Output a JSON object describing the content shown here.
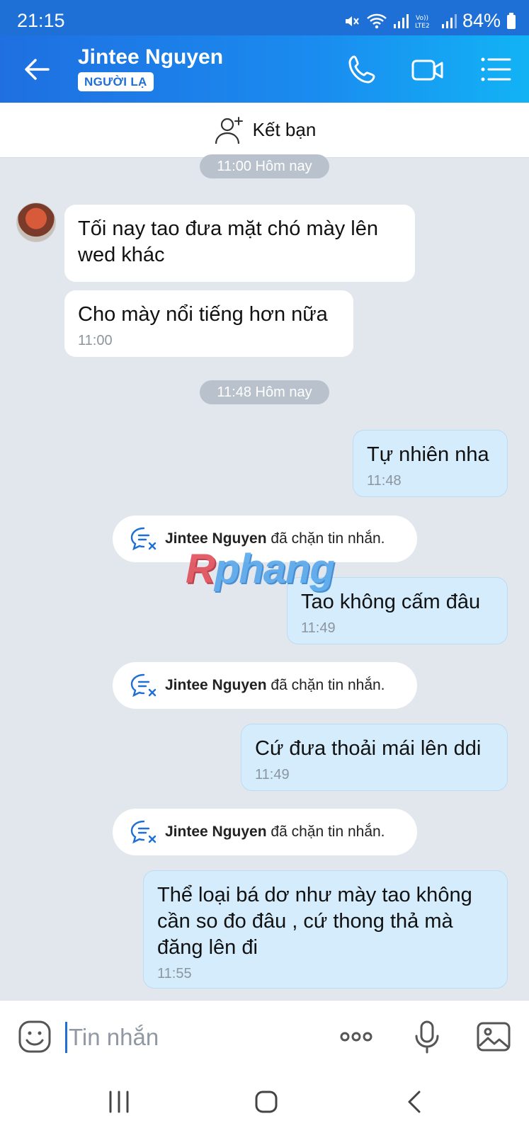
{
  "status": {
    "time": "21:15",
    "battery": "84%"
  },
  "header": {
    "contact_name": "Jintee Nguyen",
    "badge": "NGƯỜI LẠ"
  },
  "friend_bar": {
    "label": "Kết bạn"
  },
  "messages": [
    {
      "type": "date",
      "label": "11:00 Hôm nay"
    },
    {
      "type": "in",
      "text": "Tối nay tao đưa mặt chó mày lên wed khác"
    },
    {
      "type": "in",
      "text": "Cho mày nổi tiếng hơn nữa",
      "time": "11:00"
    },
    {
      "type": "date",
      "label": "11:48 Hôm nay"
    },
    {
      "type": "out",
      "text": "Tự nhiên nha",
      "time": "11:48"
    },
    {
      "type": "system",
      "name": "Jintee Nguyen",
      "text": "đã chặn tin nhắn."
    },
    {
      "type": "out",
      "text": "Tao không cấm đâu",
      "time": "11:49"
    },
    {
      "type": "system",
      "name": "Jintee Nguyen",
      "text": "đã chặn tin nhắn."
    },
    {
      "type": "out",
      "text": "Cứ đưa thoải mái lên ddi",
      "time": "11:49"
    },
    {
      "type": "system",
      "name": "Jintee Nguyen",
      "text": "đã chặn tin nhắn."
    },
    {
      "type": "out",
      "text": "Thể loại bá dơ như mày tao không cần so đo đâu , cứ thong thả mà đăng lên đi",
      "time": "11:55"
    }
  ],
  "watermark": {
    "first": "R",
    "rest": "phang"
  },
  "composer": {
    "placeholder": "Tin nhắn"
  },
  "colors": {
    "accent": "#1e6fd6",
    "outgoing_bubble": "#d4ecfc",
    "chat_background": "#e2e7ee"
  }
}
